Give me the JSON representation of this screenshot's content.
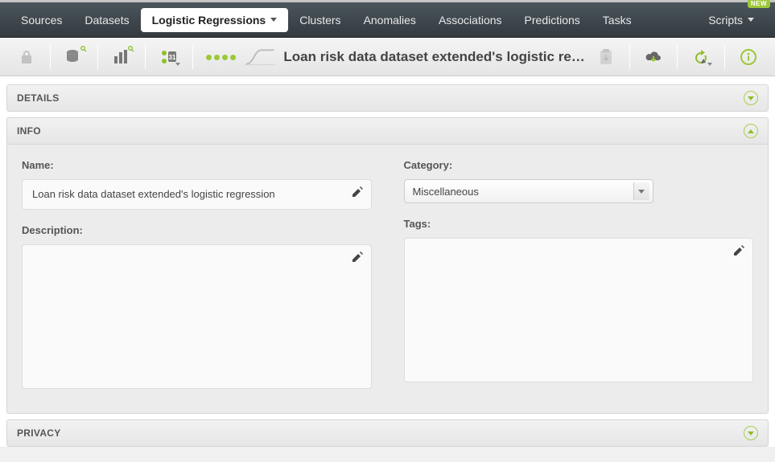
{
  "nav": {
    "items": [
      "Sources",
      "Datasets",
      "Logistic Regressions",
      "Clusters",
      "Anomalies",
      "Associations",
      "Predictions",
      "Tasks"
    ],
    "active_index": 2,
    "scripts_label": "Scripts",
    "new_badge": "NEW"
  },
  "header": {
    "title": "Loan risk data dataset extended's logistic regr…"
  },
  "sections": {
    "details": {
      "title": "DETAILS",
      "expanded": false
    },
    "info": {
      "title": "INFO",
      "expanded": true,
      "name_label": "Name:",
      "name_value": "Loan risk data dataset extended's logistic regression",
      "category_label": "Category:",
      "category_value": "Miscellaneous",
      "description_label": "Description:",
      "description_value": "",
      "tags_label": "Tags:",
      "tags_value": ""
    },
    "privacy": {
      "title": "PRIVACY",
      "expanded": false
    }
  }
}
